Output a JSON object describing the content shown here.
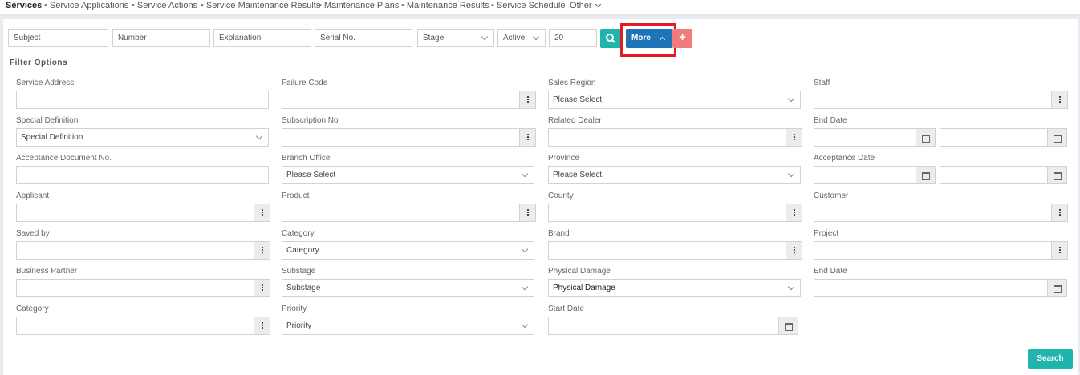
{
  "topnav": {
    "items": [
      "Services",
      "Service Applications",
      "Service Actions",
      "Service Maintenance Results",
      "Maintenance Plans",
      "Maintenance Results",
      "Service Schedule",
      "Other"
    ]
  },
  "quick_filters": {
    "subject": "Subject",
    "number": "Number",
    "explanation": "Explanation",
    "serial_no": "Serial No.",
    "stage": "Stage",
    "status": "Active",
    "page_size": "20",
    "more_label": "More",
    "add_label": "+"
  },
  "filter_options_title": "Filter Options",
  "filters": {
    "service_address": "Service Address",
    "failure_code": "Failure Code",
    "sales_region": "Sales Region",
    "sales_region_value": "Please Select",
    "staff": "Staff",
    "special_definition": "Special Definition",
    "special_definition_value": "Special Definition",
    "subscription_no": "Subscription No",
    "related_dealer": "Related Dealer",
    "end_date": "End Date",
    "acceptance_document_no": "Acceptance Document No.",
    "branch_office": "Branch Office",
    "branch_office_value": "Please Select",
    "province": "Province",
    "province_value": "Please Select",
    "acceptance_date": "Acceptance Date",
    "applicant": "Applicant",
    "product": "Product",
    "county": "County",
    "customer": "Customer",
    "saved_by": "Saved by",
    "category": "Category",
    "category_value": "Category",
    "brand": "Brand",
    "project": "Project",
    "business_partner": "Business Partner",
    "substage": "Substage",
    "substage_value": "Substage",
    "physical_damage": "Physical Damage",
    "physical_damage_value": "Physical Damage",
    "end_date_2": "End Date",
    "category_2": "Category",
    "priority": "Priority",
    "priority_value": "Priority",
    "start_date": "Start Date"
  },
  "search_label": "Search",
  "colors": {
    "teal": "#1fb5ac",
    "blue": "#1f73b7",
    "highlight": "#e51b23",
    "add": "#f17b7b"
  }
}
